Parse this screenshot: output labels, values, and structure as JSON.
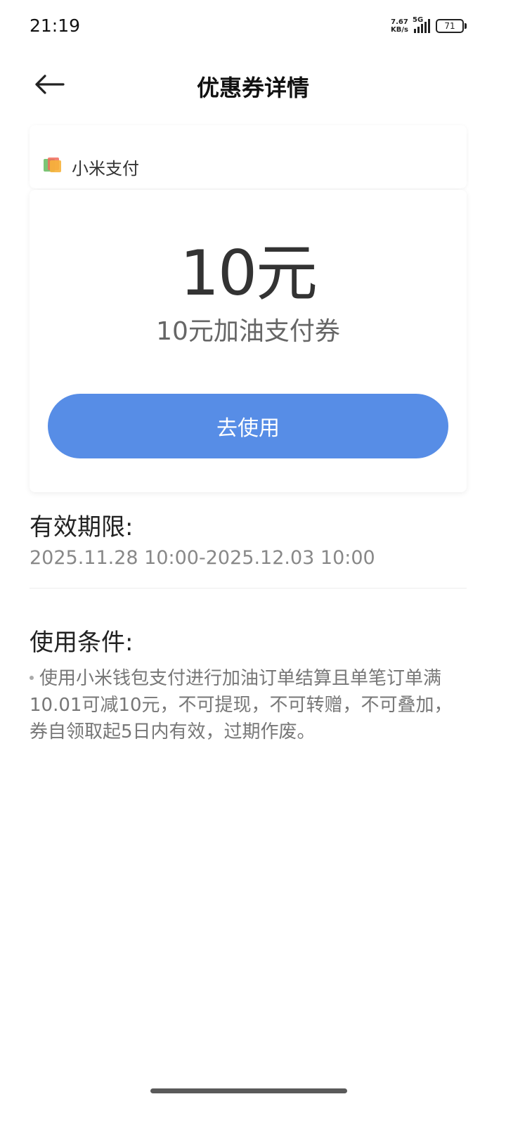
{
  "status_bar": {
    "time": "21:19",
    "net_speed_value": "7.67",
    "net_speed_unit": "KB/s",
    "network": "5G",
    "battery": "71"
  },
  "header": {
    "title": "优惠券详情",
    "back_icon": "arrow-left-icon"
  },
  "merchant": {
    "name": "小米支付",
    "logo_icon": "xiaomi-pay-logo-icon"
  },
  "coupon": {
    "amount": "10元",
    "name": "10元加油支付券",
    "use_button_label": "去使用",
    "button_color": "#578de6"
  },
  "validity": {
    "title": "有效期限:",
    "range": "2025.11.28 10:00-2025.12.03 10:00"
  },
  "conditions": {
    "title": "使用条件:",
    "text": "使用小米钱包支付进行加油订单结算且单笔订单满10.01可减10元，不可提现，不可转赠，不可叠加，券自领取起5日内有效，过期作废。"
  }
}
